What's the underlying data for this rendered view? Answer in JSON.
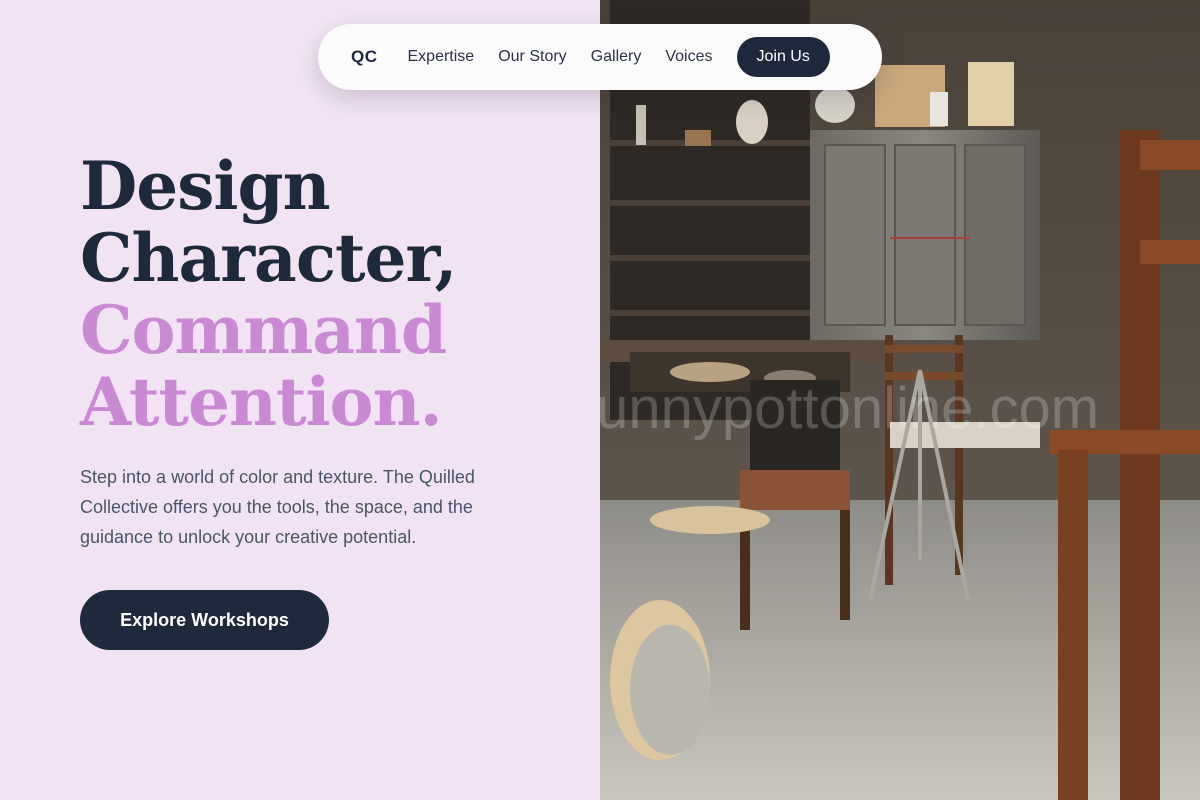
{
  "nav": {
    "logo": "QC",
    "links": [
      "Expertise",
      "Our Story",
      "Gallery",
      "Voices"
    ],
    "cta": "Join Us"
  },
  "hero": {
    "heading_lines": [
      "Design",
      "Character,",
      "Command",
      "Attention."
    ],
    "description": "Step into a world of color and texture. The Quilled Collective offers you the tools, the space, and the guidance to unlock your creative potential.",
    "button": "Explore Workshops"
  },
  "watermark": "funnypottonline.com",
  "colors": {
    "panel_background": "#f1e3f4",
    "heading_dark": "#1e293b",
    "heading_accent": "#c98ad3",
    "button_dark": "#1e293b"
  }
}
